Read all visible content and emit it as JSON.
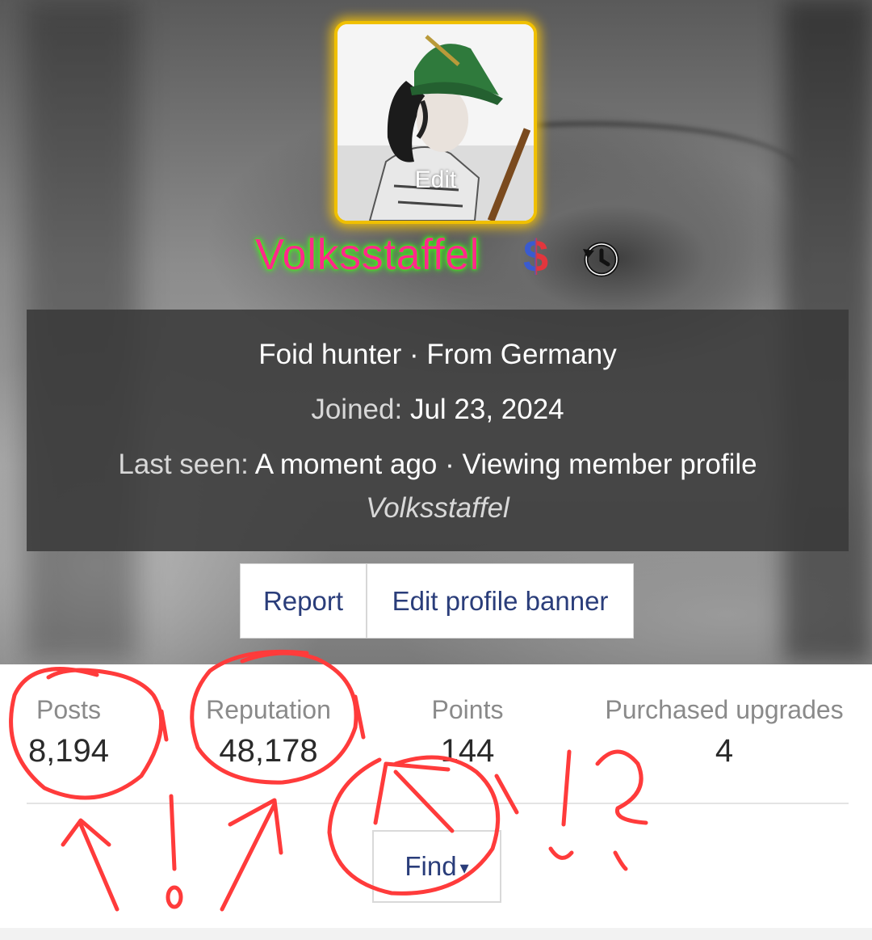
{
  "colors": {
    "username": "#ff2a8a",
    "username_glow": "#39ff14",
    "avatar_border": "#f0c000",
    "link": "#2a3d7a",
    "annotation": "#ff3b3b"
  },
  "avatar": {
    "edit_label": "Edit"
  },
  "profile": {
    "username": "Volksstaffel",
    "dollar_icon": "$",
    "title": "Foid hunter",
    "separator": " · ",
    "location": "From Germany",
    "joined_label": "Joined:",
    "joined_value": "Jul 23, 2024",
    "last_seen_label": "Last seen:",
    "last_seen_value": "A moment ago",
    "activity": "Viewing member profile",
    "activity_target": "Volksstaffel"
  },
  "actions": {
    "report_label": "Report",
    "edit_banner_label": "Edit profile banner"
  },
  "stats": [
    {
      "label": "Posts",
      "value": "8,194"
    },
    {
      "label": "Reputation",
      "value": "48,178"
    },
    {
      "label": "Points",
      "value": "144"
    },
    {
      "label": "Purchased upgrades",
      "value": "4"
    }
  ],
  "find": {
    "label": "Find",
    "caret": "▾"
  }
}
